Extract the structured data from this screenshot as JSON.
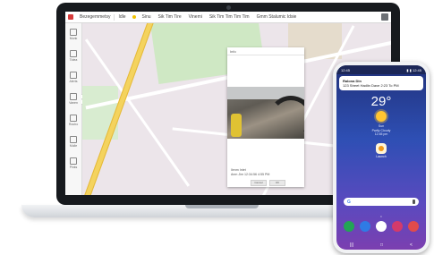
{
  "laptop": {
    "topbar": {
      "items": [
        "Bezegemmetsy",
        "Idle",
        "Sinu",
        "Sik Tim Tire",
        "Vinemi",
        "Sik Tim Tim Tim Tim",
        "Gmm Stalumic Idsie"
      ]
    },
    "sidebar": {
      "items": [
        "Munk",
        "Tidea",
        "Alerts",
        "Vanen",
        "Roubo",
        "Mulle",
        "Pinks"
      ]
    },
    "popup": {
      "header": "Info",
      "caption_line1": "Ilenm Intet",
      "caption_line2": "Anm Jim 12:34:56 4:55 PM",
      "btn_cancel": "Cancel",
      "btn_ok": "OK"
    }
  },
  "phone": {
    "status_left": "12:45",
    "status_right": "▮ ▮ 12:45",
    "notification_title": "Ralona Din",
    "notification_text": "123 Street Hadlin Dave 2:23 To PM",
    "temperature": "29°",
    "weather_line1": "Sun",
    "weather_line2": "Partly Cloudy",
    "weather_line3": "12:45 pm",
    "app_label": "Launch",
    "google_mark": "G",
    "page_dots": "• ",
    "dock_colors": [
      "#23a455",
      "#2f7be5",
      "#ffffff",
      "#d43a6b",
      "#e14b4b"
    ],
    "nav": [
      "|||",
      "□",
      "<"
    ]
  }
}
